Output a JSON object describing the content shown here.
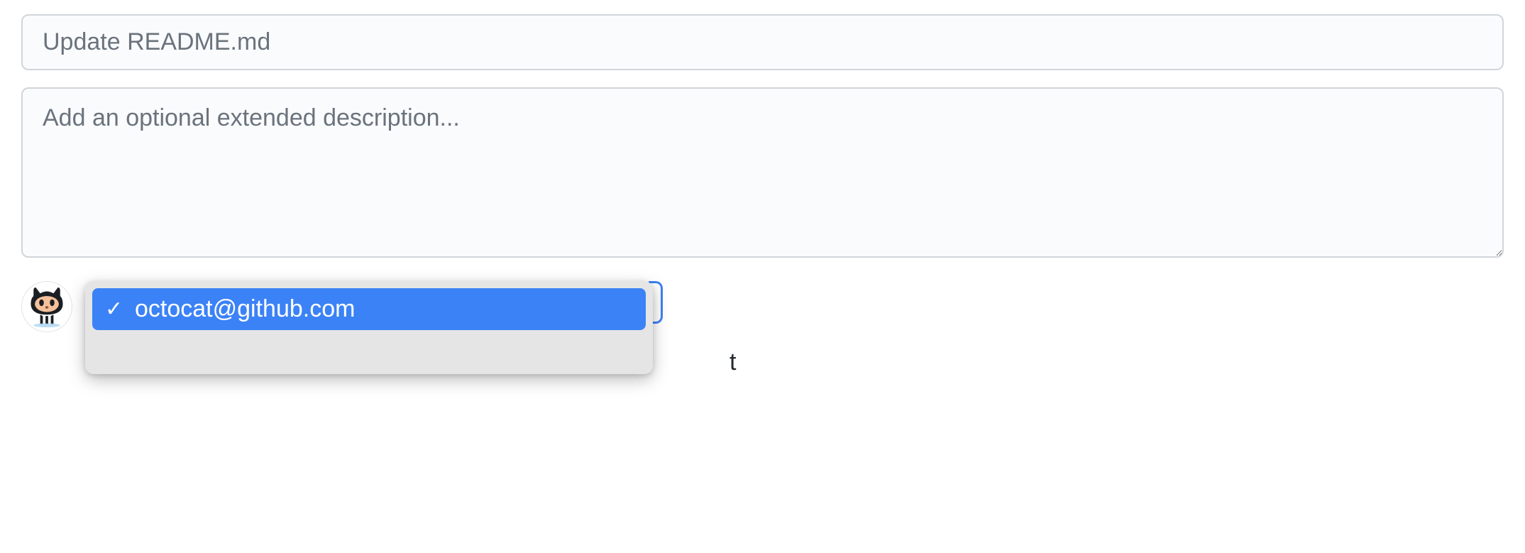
{
  "commit": {
    "title_placeholder": "Update README.md",
    "description_placeholder": "Add an optional extended description..."
  },
  "author": {
    "dropdown": {
      "items": [
        {
          "label": "octocat@github.com",
          "selected": true
        }
      ]
    },
    "trailing_text_fragment": "t"
  }
}
